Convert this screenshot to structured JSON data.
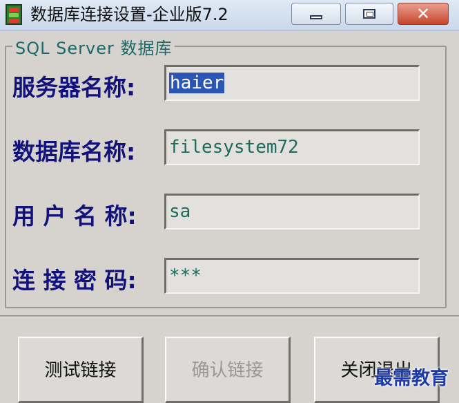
{
  "window": {
    "title": "数据库连接设置-企业版7.2",
    "controls": {
      "minimize": "minimize",
      "maximize": "maximize",
      "close": "✕"
    }
  },
  "group": {
    "legend": "SQL Server 数据库",
    "fields": [
      {
        "label": "服务器名称:",
        "value": "haier",
        "selected": true
      },
      {
        "label": "数据库名称:",
        "value": "filesystem72"
      },
      {
        "label": "用 户 名 称:",
        "value": "sa"
      },
      {
        "label": "连 接 密 码:",
        "value": "***"
      }
    ]
  },
  "buttons": {
    "test": "测试链接",
    "confirm": "确认链接",
    "close": "关闭退出"
  },
  "watermark": "最需教育",
  "colors": {
    "label": "#12127a",
    "value": "#1d6b5c",
    "selection": "#2c56b5",
    "legend": "#1a6a6a",
    "close_button": "#c7452c"
  }
}
